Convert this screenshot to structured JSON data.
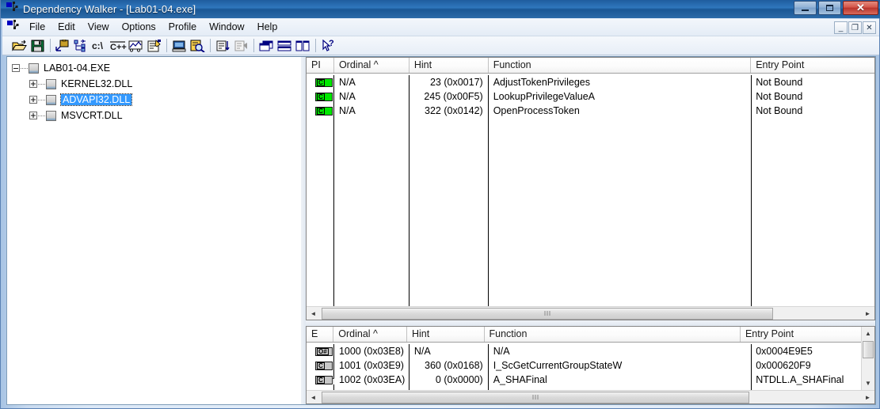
{
  "window": {
    "title": "Dependency Walker - [Lab01-04.exe]",
    "app_icon": "dependency-walker-icon",
    "buttons": {
      "minimize": "–",
      "maximize": "□",
      "close": "✕"
    }
  },
  "menubar": {
    "icon": "mdi-child-icon",
    "items": [
      "File",
      "Edit",
      "View",
      "Options",
      "Profile",
      "Window",
      "Help"
    ],
    "mdi_buttons": {
      "minimize": "_",
      "restore": "❐",
      "close": "✕"
    }
  },
  "toolbar": {
    "buttons": [
      {
        "name": "open-icon",
        "label": "Open"
      },
      {
        "name": "save-icon",
        "label": "Save"
      },
      {
        "name": "sep1",
        "label": ""
      },
      {
        "name": "view-full-paths-icon",
        "label": "View Full Paths"
      },
      {
        "name": "expand-all-icon",
        "label": "Expand All"
      },
      {
        "name": "undecorate-c-icon",
        "label": "Undecorate C++ Functions"
      },
      {
        "name": "undecorate-cpp-icon",
        "label": "Undecorate C++ Functions"
      },
      {
        "name": "view-module-paths-icon",
        "label": "View Module Paths"
      },
      {
        "name": "properties-icon",
        "label": "Properties"
      },
      {
        "name": "sep2",
        "label": ""
      },
      {
        "name": "system-info-icon",
        "label": "System Information"
      },
      {
        "name": "view-log-icon",
        "label": "View Log"
      },
      {
        "name": "sep3",
        "label": ""
      },
      {
        "name": "sort-icon",
        "label": "Sort"
      },
      {
        "name": "configure-icon",
        "label": "Configure"
      },
      {
        "name": "sep4",
        "label": ""
      },
      {
        "name": "cascade-icon",
        "label": "Cascade"
      },
      {
        "name": "tile-horizontal-icon",
        "label": "Tile Horizontally"
      },
      {
        "name": "tile-vertical-icon",
        "label": "Tile Vertically"
      },
      {
        "name": "sep5",
        "label": ""
      },
      {
        "name": "help-context-icon",
        "label": "Context Help"
      }
    ]
  },
  "tree": {
    "root": {
      "label": "LAB01-04.EXE",
      "expander": "minus",
      "selected": false
    },
    "children": [
      {
        "label": "KERNEL32.DLL",
        "expander": "plus",
        "selected": false
      },
      {
        "label": "ADVAPI32.DLL",
        "expander": "plus",
        "selected": true
      },
      {
        "label": "MSVCRT.DLL",
        "expander": "plus",
        "selected": false
      }
    ]
  },
  "import_list": {
    "columns": [
      "PI",
      "Ordinal  ^",
      "Hint",
      "Function",
      "Entry Point"
    ],
    "rows": [
      {
        "icon": "C",
        "icon_kind": "green-c",
        "ordinal": "N/A",
        "hint": "23 (0x0017)",
        "function": "AdjustTokenPrivileges",
        "entry_point": "Not Bound"
      },
      {
        "icon": "C",
        "icon_kind": "green-c",
        "ordinal": "N/A",
        "hint": "245 (0x00F5)",
        "function": "LookupPrivilegeValueA",
        "entry_point": "Not Bound"
      },
      {
        "icon": "C",
        "icon_kind": "green-c",
        "ordinal": "N/A",
        "hint": "322 (0x0142)",
        "function": "OpenProcessToken",
        "entry_point": "Not Bound"
      }
    ],
    "hscroll": {
      "thumb_grip": "‖‖",
      "left_arrow": "◄",
      "right_arrow": "►"
    }
  },
  "export_list": {
    "columns": [
      "E",
      "Ordinal  ^",
      "Hint",
      "Function",
      "Entry Point"
    ],
    "rows": [
      {
        "icon": "O#",
        "icon_kind": "gray-ordinal",
        "ordinal": "1000 (0x03E8)",
        "hint": "N/A",
        "function": "N/A",
        "entry_point": "0x0004E9E5"
      },
      {
        "icon": "C",
        "icon_kind": "gray-c",
        "ordinal": "1001 (0x03E9)",
        "hint": "360 (0x0168)",
        "function": "I_ScGetCurrentGroupStateW",
        "entry_point": "0x000620F9"
      },
      {
        "icon": "C",
        "icon_kind": "gray-c-forward",
        "ordinal": "1002 (0x03EA)",
        "hint": "0 (0x0000)",
        "function": "A_SHAFinal",
        "entry_point": "NTDLL.A_SHAFinal"
      }
    ],
    "hscroll": {
      "thumb_grip": "‖‖",
      "left_arrow": "◄",
      "right_arrow": "►"
    },
    "vscroll": {
      "up_arrow": "▲",
      "down_arrow": "▼"
    }
  },
  "colors": {
    "titlebar_blue": "#2f77bd",
    "selection_blue": "#3399ff",
    "import_icon_green": "#00e800",
    "export_icon_gray": "#c8c8c8",
    "toolbar_icon_navy": "#000080",
    "pane_border": "#848484"
  }
}
